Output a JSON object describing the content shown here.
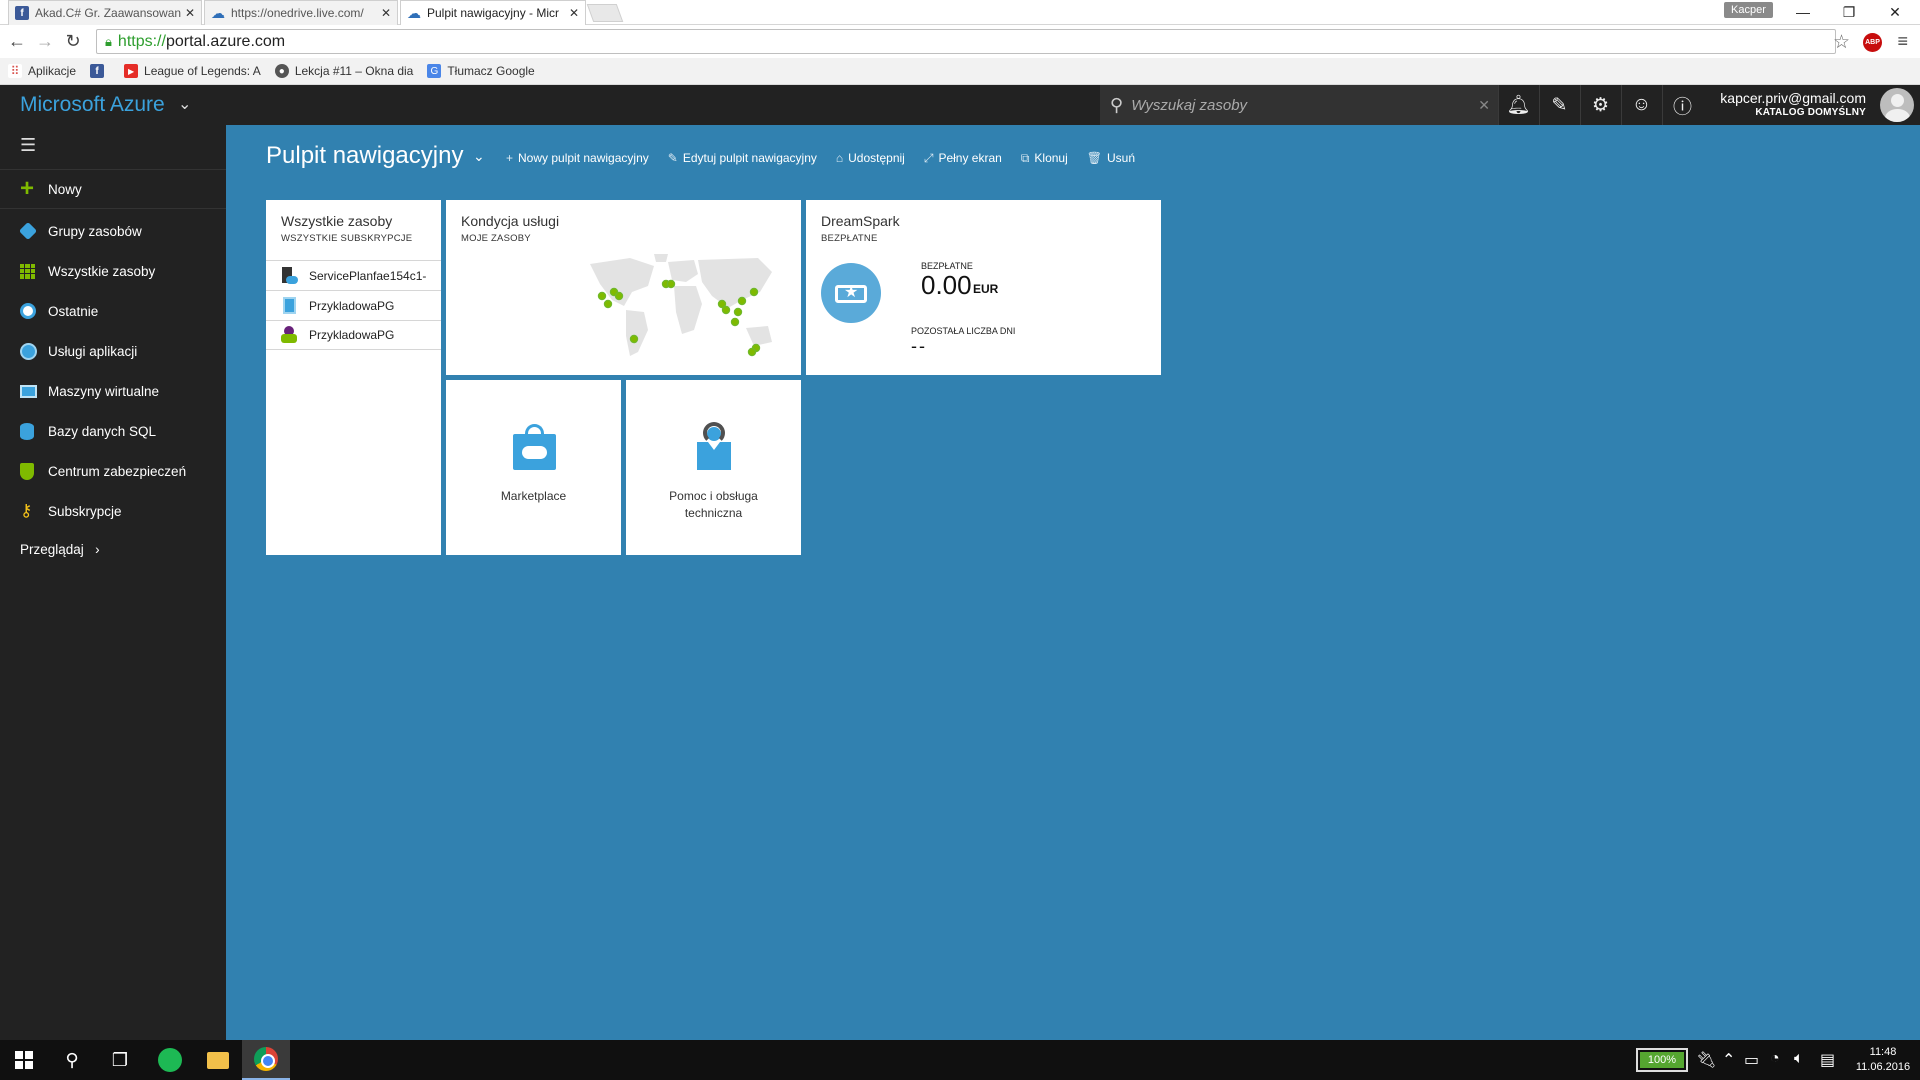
{
  "browser": {
    "tabs": [
      {
        "title": "Akad.C# Gr. Zaawansowan",
        "favicon": "facebook-icon"
      },
      {
        "title": "https://onedrive.live.com/",
        "favicon": "onedrive-icon"
      },
      {
        "title": "Pulpit nawigacyjny - Micr",
        "favicon": "azure-cloud-icon"
      }
    ],
    "profile_name": "Kacper",
    "url_scheme": "https://",
    "url_host": "portal.azure.com",
    "bookmarks": [
      {
        "label": "Aplikacje",
        "icon": "apps-grid-icon"
      },
      {
        "label": "",
        "icon": "facebook-icon"
      },
      {
        "label": "League of Legends: A",
        "icon": "youtube-icon"
      },
      {
        "label": "Lekcja #11 – Okna dia",
        "icon": "site-icon"
      },
      {
        "label": "Tłumacz Google",
        "icon": "google-translate-icon"
      }
    ]
  },
  "azure": {
    "brand": "Microsoft Azure",
    "brand_color": "#3ba2dd",
    "search_placeholder": "Wyszukaj zasoby",
    "account_email": "kapcer.priv@gmail.com",
    "account_directory": "KATALOG DOMYŚLNY"
  },
  "sidebar": {
    "new_label": "Nowy",
    "items": [
      {
        "label": "Grupy zasobów",
        "icon": "resource-groups-icon"
      },
      {
        "label": "Wszystkie zasoby",
        "icon": "all-resources-icon"
      },
      {
        "label": "Ostatnie",
        "icon": "recent-clock-icon"
      },
      {
        "label": "Usługi aplikacji",
        "icon": "app-services-icon"
      },
      {
        "label": "Maszyny wirtualne",
        "icon": "virtual-machines-icon"
      },
      {
        "label": "Bazy danych SQL",
        "icon": "sql-database-icon"
      },
      {
        "label": "Centrum zabezpieczeń",
        "icon": "security-center-icon"
      },
      {
        "label": "Subskrypcje",
        "icon": "subscriptions-key-icon"
      }
    ],
    "browse_label": "Przeglądaj"
  },
  "dashboard": {
    "title": "Pulpit nawigacyjny",
    "toolbar": {
      "new_dashboard": "Nowy pulpit nawigacyjny",
      "edit_dashboard": "Edytuj pulpit nawigacyjny",
      "share": "Udostępnij",
      "fullscreen": "Pełny ekran",
      "clone": "Klonuj",
      "delete": "Usuń"
    },
    "all_resources": {
      "title": "Wszystkie zasoby",
      "subtitle": "WSZYSTKIE SUBSKRYPCJE",
      "rows": [
        {
          "name": "ServicePlanfae154c1-",
          "icon": "app-service-plan-icon"
        },
        {
          "name": "PrzykladowaPG",
          "icon": "web-app-icon"
        },
        {
          "name": "PrzykladowaPG",
          "icon": "app-insights-icon"
        }
      ]
    },
    "service_health": {
      "title": "Kondycja usługi",
      "subtitle": "MOJE ZASOBY"
    },
    "dreamspark": {
      "title": "DreamSpark",
      "subtitle": "BEZPŁATNE",
      "free_label": "BEZPŁATNE",
      "amount": "0.00",
      "currency": "EUR",
      "days_label": "POZOSTAŁA LICZBA DNI",
      "days_value": "--"
    },
    "marketplace": {
      "label": "Marketplace"
    },
    "help": {
      "label_line1": "Pomoc i obsługa",
      "label_line2": "techniczna"
    }
  },
  "taskbar": {
    "battery": "100%",
    "time": "11:48",
    "date": "11.06.2016"
  }
}
